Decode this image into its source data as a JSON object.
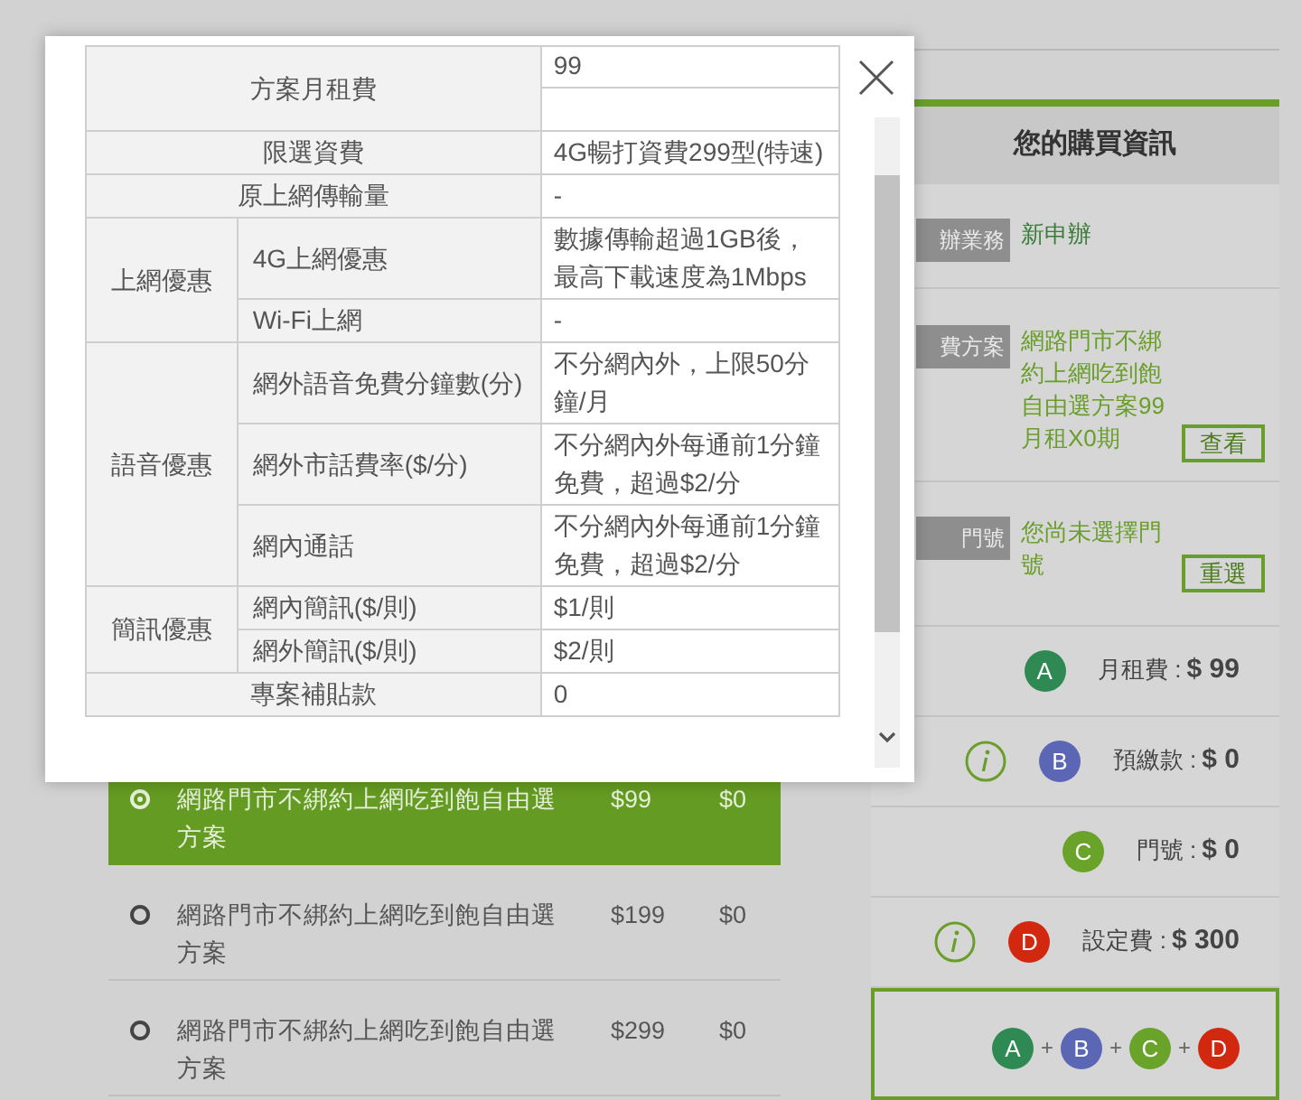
{
  "modal": {
    "spec_table": [
      {
        "kind": "field",
        "label": "方案月租費",
        "value": "99"
      },
      {
        "kind": "single",
        "label": "限選資費",
        "value": "4G暢打資費299型(特速)"
      },
      {
        "kind": "single",
        "label": "原上網傳輸量",
        "value": "-"
      },
      {
        "kind": "group",
        "label": "上網優惠",
        "items": [
          {
            "label": "4G上網優惠",
            "value": "數據傳輸超過1GB後，最高下載速度為1Mbps"
          },
          {
            "label": "Wi-Fi上網",
            "value": "-"
          }
        ]
      },
      {
        "kind": "group",
        "label": "語音優惠",
        "items": [
          {
            "label": "網外語音免費分鐘數(分)",
            "value": "不分網內外，上限50分鐘/月"
          },
          {
            "label": "網外市話費率($/分)",
            "value": "不分網內外每通前1分鐘免費，超過$2/分"
          },
          {
            "label": "網內通話",
            "value": "不分網內外每通前1分鐘免費，超過$2/分"
          }
        ]
      },
      {
        "kind": "group",
        "label": "簡訊優惠",
        "items": [
          {
            "label": "網內簡訊($/則)",
            "value": "$1/則"
          },
          {
            "label": "網外簡訊($/則)",
            "value": "$2/則"
          }
        ]
      },
      {
        "kind": "single",
        "label": "專案補貼款",
        "value": "0"
      }
    ]
  },
  "plans": [
    {
      "name": "網路門市不綁約上網吃到飽自由選方案",
      "price": "$99",
      "deposit": "$0",
      "selected": true
    },
    {
      "name": "網路門市不綁約上網吃到飽自由選方案",
      "price": "$199",
      "deposit": "$0",
      "selected": false
    },
    {
      "name": "網路門市不綁約上網吃到飽自由選方案",
      "price": "$299",
      "deposit": "$0",
      "selected": false
    }
  ],
  "purchase_panel": {
    "title": "您的購買資訊",
    "details": [
      {
        "label": "辦業務",
        "value": "新申辦",
        "color": "#3a7d3a"
      },
      {
        "label": "費方案",
        "value": "網路門市不綁約上網吃到飽自由選方案99月租X0期",
        "button": "查看",
        "color": "#6a9e2a"
      },
      {
        "label": "門號",
        "value": "您尚未選擇門號",
        "button": "重選",
        "color": "#6a9e2a"
      }
    ],
    "charges": [
      {
        "badge": "A",
        "color": "#2e8a52",
        "info": false,
        "label": "月租費 :",
        "amount": "$ 99"
      },
      {
        "badge": "B",
        "color": "#5b66b5",
        "info": true,
        "label": "預繳款 :",
        "amount": "$ 0"
      },
      {
        "badge": "C",
        "color": "#6aa329",
        "info": false,
        "label": "門號 :",
        "amount": "$ 0"
      },
      {
        "badge": "D",
        "color": "#d2280f",
        "info": true,
        "label": "設定費 :",
        "amount": "$ 300"
      }
    ],
    "total_formula": [
      {
        "kind": "badge",
        "text": "A",
        "color": "#2e8a52"
      },
      {
        "kind": "operator",
        "text": "+"
      },
      {
        "kind": "badge",
        "text": "B",
        "color": "#5b66b5"
      },
      {
        "kind": "operator",
        "text": "+"
      },
      {
        "kind": "badge",
        "text": "C",
        "color": "#6aa329"
      },
      {
        "kind": "operator",
        "text": "+"
      },
      {
        "kind": "badge",
        "text": "D",
        "color": "#d2280f"
      }
    ]
  }
}
